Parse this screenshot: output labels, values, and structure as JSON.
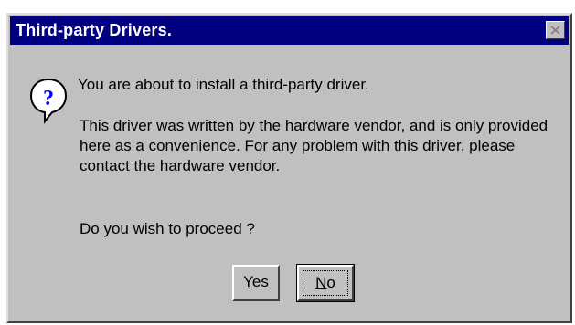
{
  "dialog": {
    "title": "Third-party Drivers.",
    "icon": "question-icon",
    "message_main": "You are about to install a third-party driver.",
    "message_body": [
      "This driver was written by the hardware vendor, and is only provided",
      "here as a convenience.  For any problem with this driver, please",
      "contact the hardware vendor."
    ],
    "message_ask": "Do you wish to proceed ?",
    "buttons": {
      "yes_label": "Yes",
      "no_label": "No"
    }
  },
  "colors": {
    "titlebar": "#000080",
    "face": "#c0c0c0"
  }
}
